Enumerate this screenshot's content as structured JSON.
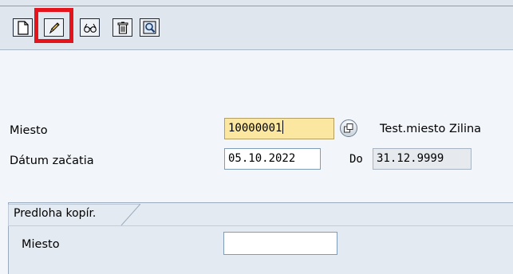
{
  "toolbar": {
    "buttons": [
      {
        "name": "create-button",
        "icon": "new-document-icon"
      },
      {
        "name": "change-button",
        "icon": "pencil-icon"
      },
      {
        "name": "display-button",
        "icon": "glasses-icon"
      },
      {
        "name": "delete-button",
        "icon": "trash-icon"
      },
      {
        "name": "find-button",
        "icon": "search-icon"
      }
    ],
    "highlighted": "change-button"
  },
  "form": {
    "location_label": "Miesto",
    "location_value": "10000001",
    "location_description": "Test.miesto Zilina",
    "start_date_label": "Dátum začatia",
    "start_date_value": "05.10.2022",
    "to_label": "Do",
    "end_date_value": "31.12.9999"
  },
  "copy_template": {
    "tab_label": "Predloha kopír.",
    "location_label": "Miesto",
    "location_value": ""
  },
  "colors": {
    "highlight": "#e5141c",
    "focused_field": "#fbe79f",
    "background": "#f2f5f9"
  }
}
